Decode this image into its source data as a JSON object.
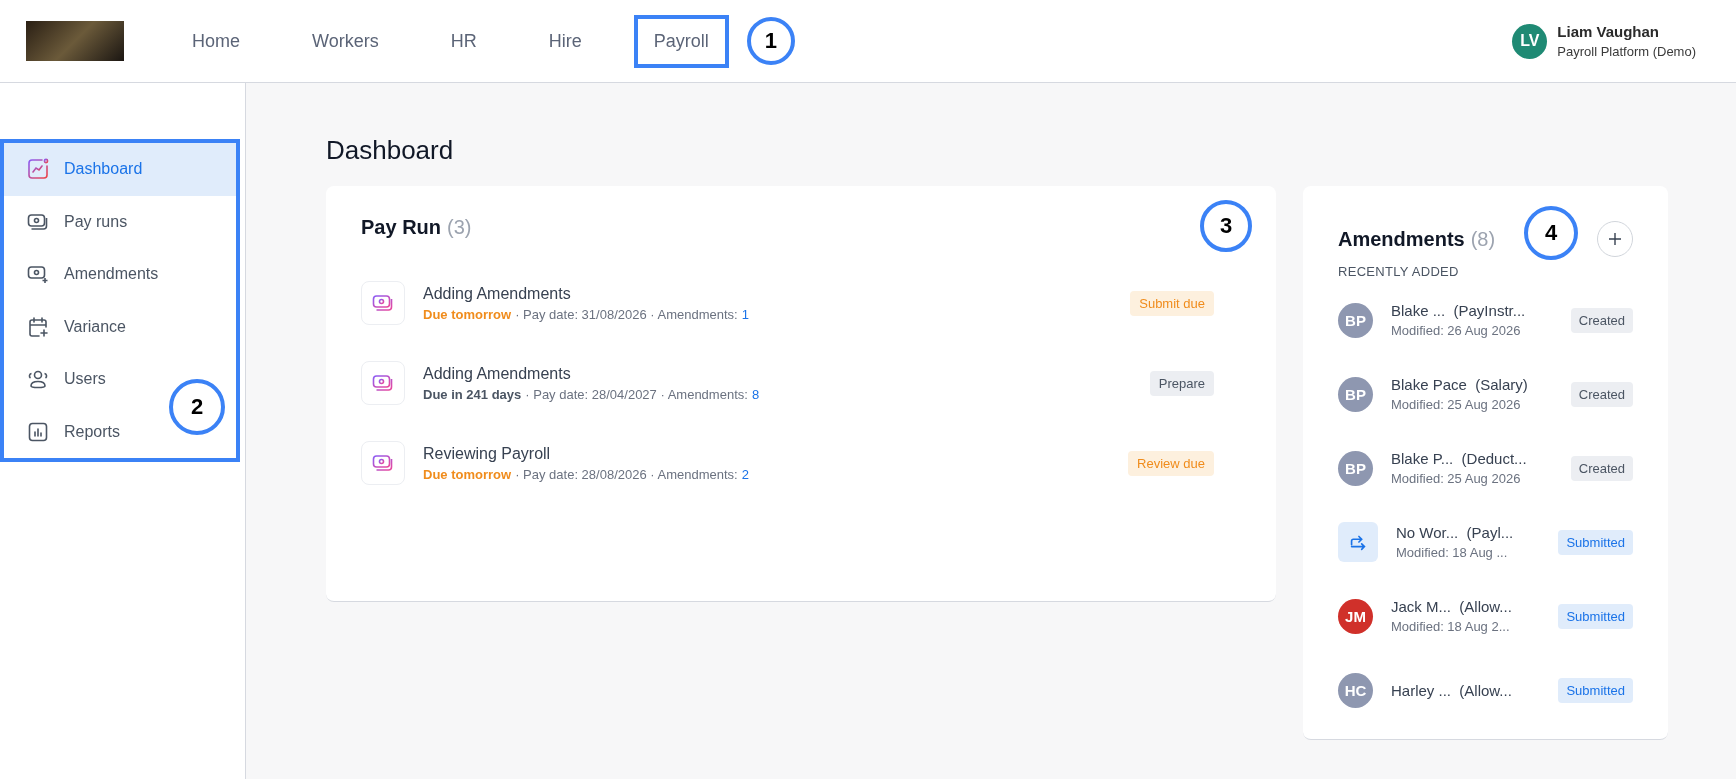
{
  "header": {
    "nav": [
      {
        "label": "Home",
        "highlighted": false
      },
      {
        "label": "Workers",
        "highlighted": false
      },
      {
        "label": "HR",
        "highlighted": false
      },
      {
        "label": "Hire",
        "highlighted": false
      },
      {
        "label": "Payroll",
        "highlighted": true,
        "callout": "1"
      }
    ],
    "user": {
      "initials": "LV",
      "name": "Liam Vaughan",
      "org": "Payroll Platform (Demo)"
    }
  },
  "sidebar": {
    "callout": "2",
    "items": [
      {
        "label": "Dashboard",
        "kind": "chart",
        "selected": true
      },
      {
        "label": "Pay runs",
        "kind": "money",
        "selected": false
      },
      {
        "label": "Amendments",
        "kind": "money-plus",
        "selected": false
      },
      {
        "label": "Variance",
        "kind": "calendar",
        "selected": false
      },
      {
        "label": "Users",
        "kind": "users",
        "selected": false
      },
      {
        "label": "Reports",
        "kind": "report",
        "selected": false
      }
    ]
  },
  "page_title": "Dashboard",
  "pay_run": {
    "title": "Pay Run",
    "count": "(3)",
    "callout": "3",
    "items": [
      {
        "name": "Adding Amendments",
        "due": "Due tomorrow",
        "urgent": true,
        "pay_date": "· Pay date: 31/08/2026 · Amendments:",
        "amendments": "1",
        "badge": "Submit due"
      },
      {
        "name": "Adding Amendments",
        "due": "Due in 241 days",
        "urgent": false,
        "pay_date": "· Pay date: 28/04/2027 · Amendments:",
        "amendments": "8",
        "badge": "Prepare"
      },
      {
        "name": "Reviewing Payroll",
        "due": "Due tomorrow",
        "urgent": true,
        "pay_date": "· Pay date: 28/08/2026 · Amendments:",
        "amendments": "2",
        "badge": "Review due"
      }
    ]
  },
  "amendments": {
    "title": "Amendments",
    "count": "(8)",
    "callout": "4",
    "subtitle": "RECENTLY ADDED",
    "items": [
      {
        "kind": "initials",
        "initials": "BP",
        "color": "#8e97b0",
        "name": "Blake ...",
        "type": "(PayInstr...",
        "modified": "Modified: 26 Aug 2026",
        "status": "Created",
        "submitted": false
      },
      {
        "kind": "initials",
        "initials": "BP",
        "color": "#8e97b0",
        "name": "Blake Pace",
        "type": "(Salary)",
        "modified": "Modified: 25 Aug 2026",
        "status": "Created",
        "submitted": false
      },
      {
        "kind": "initials",
        "initials": "BP",
        "color": "#8e97b0",
        "name": "Blake P...",
        "type": "(Deduct...",
        "modified": "Modified: 25 Aug 2026",
        "status": "Created",
        "submitted": false
      },
      {
        "kind": "icon",
        "name": "No Wor...",
        "type": "(Payl...",
        "modified": "Modified: 18 Aug ...",
        "status": "Submitted",
        "submitted": true
      },
      {
        "kind": "initials",
        "initials": "JM",
        "color": "#d0302a",
        "name": "Jack M...",
        "type": "(Allow...",
        "modified": "Modified: 18 Aug 2...",
        "status": "Submitted",
        "submitted": true
      },
      {
        "kind": "initials",
        "initials": "HC",
        "color": "#8e97b0",
        "name": "Harley ...",
        "type": "(Allow...",
        "status": "Submitted",
        "submitted": true
      }
    ]
  }
}
